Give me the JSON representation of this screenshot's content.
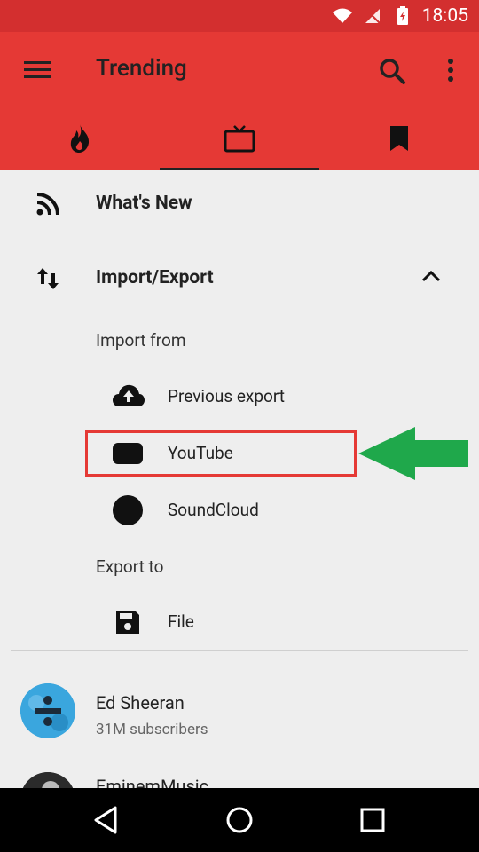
{
  "status": {
    "time": "18:05"
  },
  "appbar": {
    "title": "Trending"
  },
  "tabs": [
    {
      "name": "fire",
      "active": false
    },
    {
      "name": "tv",
      "active": true
    },
    {
      "name": "bookmark",
      "active": false
    }
  ],
  "drawer": {
    "whats_new": "What's New",
    "import_export": "Import/Export",
    "import_from": "Import from",
    "import_items": [
      "Previous export",
      "YouTube",
      "SoundCloud"
    ],
    "export_to": "Export to",
    "export_items": [
      "File"
    ]
  },
  "channels": [
    {
      "name": "Ed Sheeran",
      "subscribers": "31M subscribers"
    },
    {
      "name": "EminemMusic",
      "subscribers": ""
    }
  ],
  "colors": {
    "primary": "#e53935",
    "primary_dark": "#d32f2f",
    "annotation_red": "#e53935",
    "annotation_green": "#1fa84b"
  }
}
